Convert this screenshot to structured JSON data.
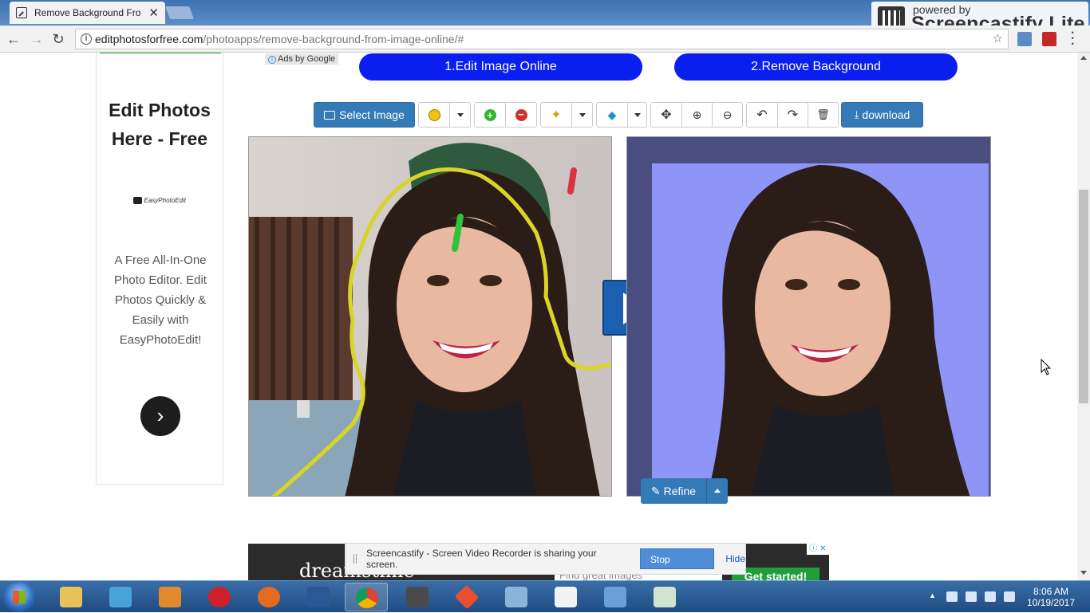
{
  "browser": {
    "tab_title": "Remove Background Fro",
    "url_host": "editphotosforfree.com",
    "url_path": "/photoapps/remove-background-from-image-online/#"
  },
  "screencastify_badge": {
    "powered_by": "powered by",
    "name": "Screencastify Lite"
  },
  "ads": {
    "ad_choices": "Ads by Google",
    "bottom_brand": "dreamstime",
    "bottom_search_placeholder": "Find great images",
    "bottom_cta": "Get started!"
  },
  "sidebar": {
    "heading": "Edit Photos Here - Free",
    "logo_text": "EasyPhotoEdit",
    "description": "A Free All-In-One Photo Editor. Edit Photos Quickly & Easily with EasyPhotoEdit!"
  },
  "steps": {
    "step1": "1.Edit Image Online",
    "step2": "2.Remove Background"
  },
  "toolbar": {
    "select_image": "Select Image",
    "download": "download",
    "colors": {
      "brush": "#f1c40f",
      "add": "#2db82d",
      "remove": "#d32f2f",
      "primary": "#337ab7",
      "step_button": "#0a1ef0",
      "result_background": "#8f95f7"
    }
  },
  "editor": {
    "refine_label": "Refine"
  },
  "share_bar": {
    "message": "Screencastify - Screen Video Recorder is sharing your screen.",
    "stop": "Stop sharing",
    "hide": "Hide"
  },
  "taskbar": {
    "time": "8:06 AM",
    "date": "10/19/2017"
  }
}
